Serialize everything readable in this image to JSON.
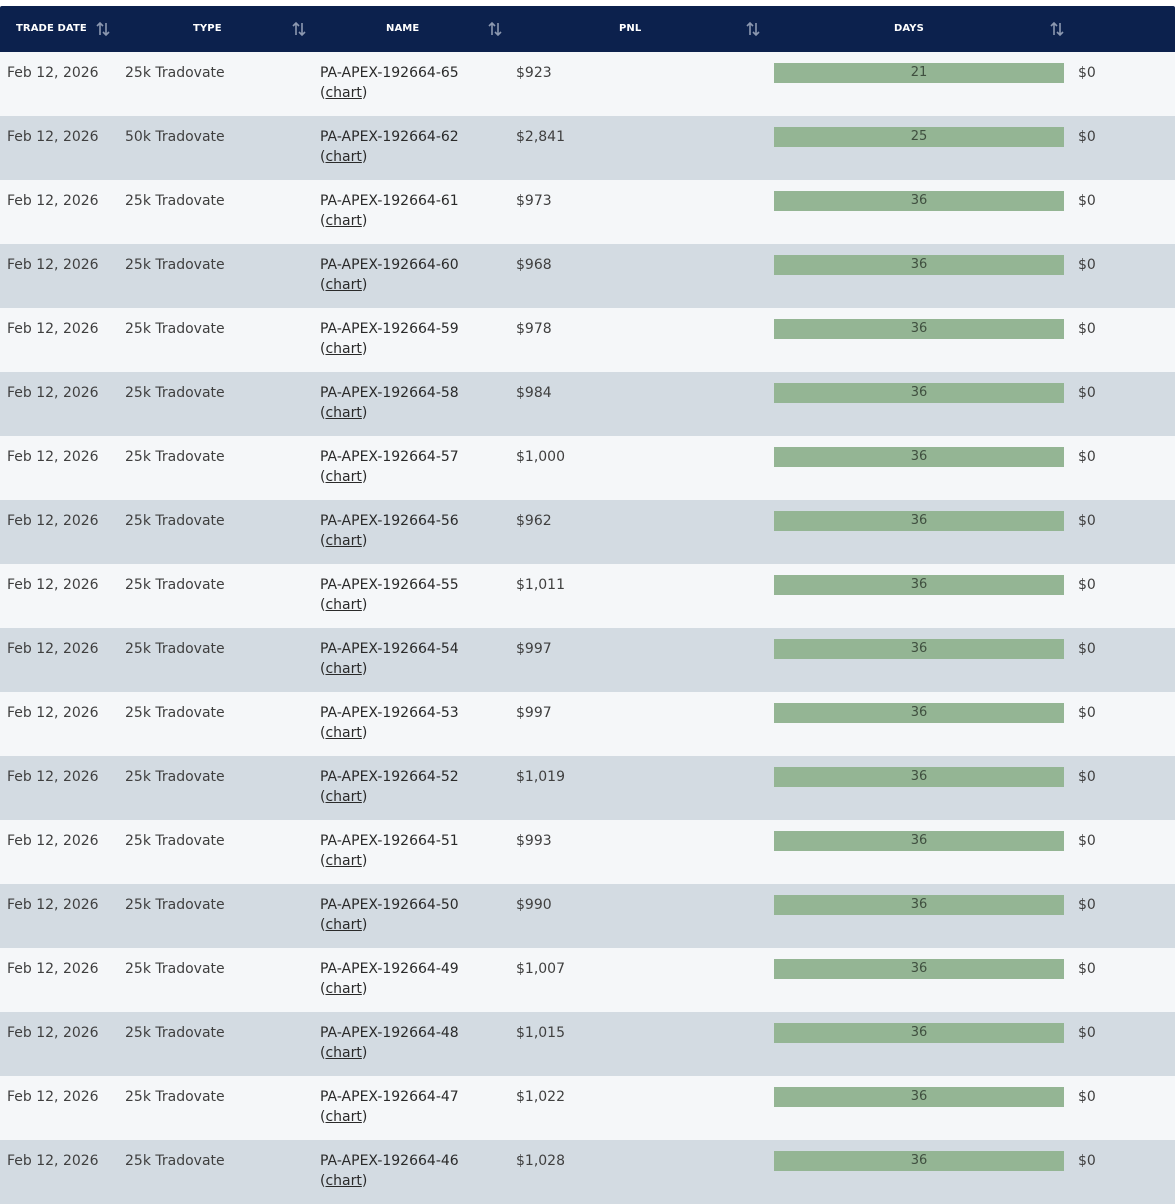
{
  "headers": {
    "trade_date": "TRADE DATE",
    "type": "TYPE",
    "name": "NAME",
    "pnl": "PNL",
    "days": "DAYS"
  },
  "chart_link_label": "chart",
  "rows": [
    {
      "date": "Feb 12, 2026",
      "type": "25k Tradovate",
      "name": "PA-APEX-192664-65",
      "pnl": "$923",
      "days": "21",
      "last": "$0"
    },
    {
      "date": "Feb 12, 2026",
      "type": "50k Tradovate",
      "name": "PA-APEX-192664-62",
      "pnl": "$2,841",
      "days": "25",
      "last": "$0"
    },
    {
      "date": "Feb 12, 2026",
      "type": "25k Tradovate",
      "name": "PA-APEX-192664-61",
      "pnl": "$973",
      "days": "36",
      "last": "$0"
    },
    {
      "date": "Feb 12, 2026",
      "type": "25k Tradovate",
      "name": "PA-APEX-192664-60",
      "pnl": "$968",
      "days": "36",
      "last": "$0"
    },
    {
      "date": "Feb 12, 2026",
      "type": "25k Tradovate",
      "name": "PA-APEX-192664-59",
      "pnl": "$978",
      "days": "36",
      "last": "$0"
    },
    {
      "date": "Feb 12, 2026",
      "type": "25k Tradovate",
      "name": "PA-APEX-192664-58",
      "pnl": "$984",
      "days": "36",
      "last": "$0"
    },
    {
      "date": "Feb 12, 2026",
      "type": "25k Tradovate",
      "name": "PA-APEX-192664-57",
      "pnl": "$1,000",
      "days": "36",
      "last": "$0"
    },
    {
      "date": "Feb 12, 2026",
      "type": "25k Tradovate",
      "name": "PA-APEX-192664-56",
      "pnl": "$962",
      "days": "36",
      "last": "$0"
    },
    {
      "date": "Feb 12, 2026",
      "type": "25k Tradovate",
      "name": "PA-APEX-192664-55",
      "pnl": "$1,011",
      "days": "36",
      "last": "$0"
    },
    {
      "date": "Feb 12, 2026",
      "type": "25k Tradovate",
      "name": "PA-APEX-192664-54",
      "pnl": "$997",
      "days": "36",
      "last": "$0"
    },
    {
      "date": "Feb 12, 2026",
      "type": "25k Tradovate",
      "name": "PA-APEX-192664-53",
      "pnl": "$997",
      "days": "36",
      "last": "$0"
    },
    {
      "date": "Feb 12, 2026",
      "type": "25k Tradovate",
      "name": "PA-APEX-192664-52",
      "pnl": "$1,019",
      "days": "36",
      "last": "$0"
    },
    {
      "date": "Feb 12, 2026",
      "type": "25k Tradovate",
      "name": "PA-APEX-192664-51",
      "pnl": "$993",
      "days": "36",
      "last": "$0"
    },
    {
      "date": "Feb 12, 2026",
      "type": "25k Tradovate",
      "name": "PA-APEX-192664-50",
      "pnl": "$990",
      "days": "36",
      "last": "$0"
    },
    {
      "date": "Feb 12, 2026",
      "type": "25k Tradovate",
      "name": "PA-APEX-192664-49",
      "pnl": "$1,007",
      "days": "36",
      "last": "$0"
    },
    {
      "date": "Feb 12, 2026",
      "type": "25k Tradovate",
      "name": "PA-APEX-192664-48",
      "pnl": "$1,015",
      "days": "36",
      "last": "$0"
    },
    {
      "date": "Feb 12, 2026",
      "type": "25k Tradovate",
      "name": "PA-APEX-192664-47",
      "pnl": "$1,022",
      "days": "36",
      "last": "$0"
    },
    {
      "date": "Feb 12, 2026",
      "type": "25k Tradovate",
      "name": "PA-APEX-192664-46",
      "pnl": "$1,028",
      "days": "36",
      "last": "$0"
    }
  ],
  "colors": {
    "header_bg": "#0c214d",
    "row_light": "#f5f7f9",
    "row_dark": "#d3dbe2",
    "days_bar": "#94b594"
  },
  "icons": {
    "sort": "sort-arrows-icon"
  }
}
